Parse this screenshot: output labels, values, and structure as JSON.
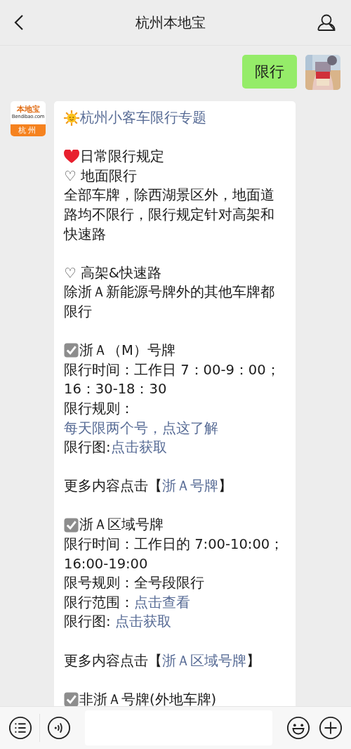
{
  "header": {
    "title": "杭州本地宝"
  },
  "sent": {
    "text": "限行"
  },
  "sender_logo": {
    "name": "本地宝",
    "site": "Bendibao.com",
    "city": "杭州"
  },
  "reply": [
    {
      "kind": "sun_title",
      "text": "杭州小客车限行专题"
    },
    {
      "kind": "gap"
    },
    {
      "kind": "heart_heading",
      "text": "日常限行规定"
    },
    {
      "kind": "text",
      "text": "♡ 地面限行"
    },
    {
      "kind": "text",
      "text": "全部车牌，除西湖景区外，地面道路均不限行，限行规定针对高架和快速路"
    },
    {
      "kind": "gap"
    },
    {
      "kind": "text",
      "text": "♡ 高架&快速路"
    },
    {
      "kind": "text",
      "text": "除浙Ａ新能源号牌外的其他车牌都限行"
    },
    {
      "kind": "gap"
    },
    {
      "kind": "check_heading",
      "text": "浙Ａ（M）号牌"
    },
    {
      "kind": "text",
      "text": "限行时间：工作日 7：00-9：00；16：30-18：30"
    },
    {
      "kind": "field",
      "label": "限行规则：",
      "link": "每天限两个号，点这了解"
    },
    {
      "kind": "field",
      "label": "限行图:",
      "link": "点击获取"
    },
    {
      "kind": "gap"
    },
    {
      "kind": "more",
      "label": "更多内容点击【",
      "link": "浙Ａ号牌",
      "end": "】"
    },
    {
      "kind": "gap"
    },
    {
      "kind": "check_heading",
      "text": "浙Ａ区域号牌"
    },
    {
      "kind": "text",
      "text": "限行时间：工作日的 7:00-10:00；16:00-19:00"
    },
    {
      "kind": "text",
      "text": "限号规则：全号段限行"
    },
    {
      "kind": "field",
      "label": "限行范围：",
      "link": "点击查看"
    },
    {
      "kind": "field",
      "label": "限行图: ",
      "link": "点击获取"
    },
    {
      "kind": "gap"
    },
    {
      "kind": "more",
      "label": "更多内容点击【",
      "link": "浙Ａ区域号牌",
      "end": "】"
    },
    {
      "kind": "gap"
    },
    {
      "kind": "check_heading",
      "text": "非浙Ａ号牌(外地车牌)"
    }
  ]
}
